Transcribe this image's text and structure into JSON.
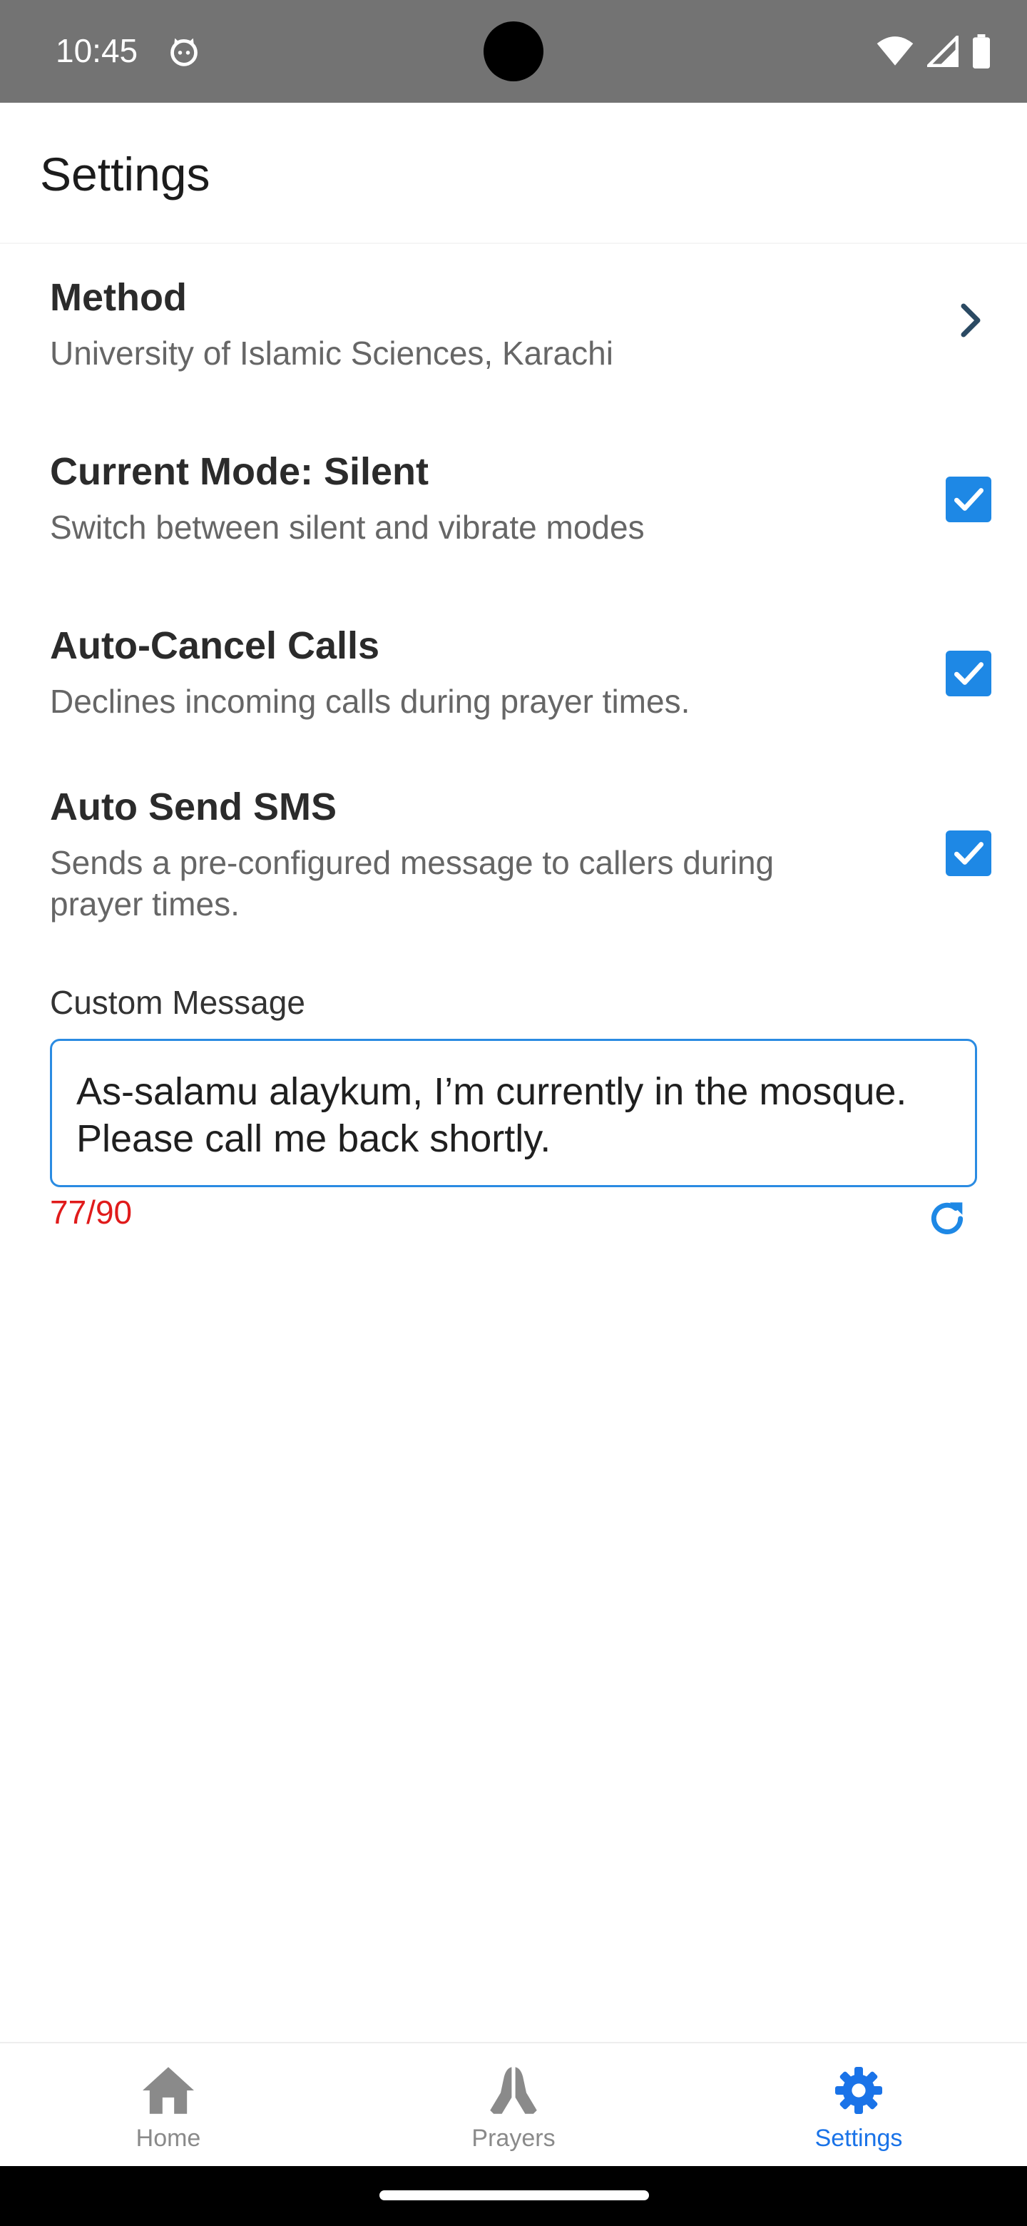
{
  "status_bar": {
    "time": "10:45",
    "icons": [
      "cat-icon",
      "wifi-icon",
      "signal-icon",
      "battery-icon"
    ]
  },
  "header": {
    "title": "Settings"
  },
  "settings": {
    "method": {
      "title": "Method",
      "subtitle": "University of Islamic Sciences, Karachi"
    },
    "mode": {
      "title": "Current Mode: Silent",
      "subtitle": "Switch between silent and vibrate modes",
      "checked": true
    },
    "auto_cancel": {
      "title": "Auto-Cancel Calls",
      "subtitle": "Declines incoming calls during prayer times.",
      "checked": true
    },
    "auto_sms": {
      "title": "Auto Send SMS",
      "subtitle": "Sends a pre-configured message to callers during prayer times.",
      "checked": true
    }
  },
  "custom_message": {
    "label": "Custom Message",
    "value": "As-salamu alaykum, I’m currently in the mosque. Please call me back shortly.",
    "counter": "77/90"
  },
  "bottom_nav": {
    "items": [
      {
        "label": "Home",
        "icon": "home-icon",
        "active": false
      },
      {
        "label": "Prayers",
        "icon": "praying-hands-icon",
        "active": false
      },
      {
        "label": "Settings",
        "icon": "gear-icon",
        "active": true
      }
    ]
  },
  "colors": {
    "accent": "#1e88e5",
    "active_nav": "#1a73e8",
    "inactive_nav": "#8a8a8a",
    "counter": "#e01b1b",
    "status_bar": "#737373"
  }
}
